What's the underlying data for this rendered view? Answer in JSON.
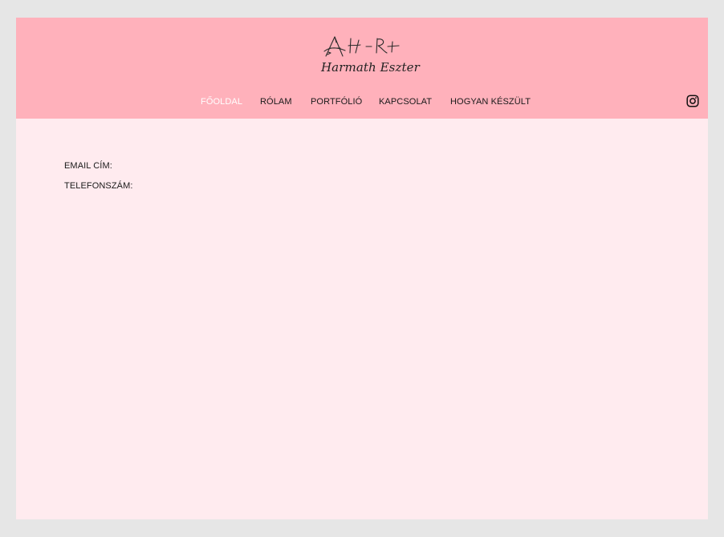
{
  "header": {
    "logo_mark_text": "AH-R+",
    "logo_name": "Harmath Eszter"
  },
  "nav": {
    "items": [
      {
        "label": "FŐOLDAL",
        "active": true
      },
      {
        "label": "RÓLAM",
        "active": false
      },
      {
        "label": "PORTFÓLIÓ",
        "active": false
      },
      {
        "label": "KAPCSOLAT",
        "active": false
      },
      {
        "label": "HOGYAN KÉSZÜLT",
        "active": false
      }
    ],
    "social_icon": "instagram-icon"
  },
  "contact": {
    "email_label": "EMAIL CÍM:",
    "phone_label": "TELEFONSZÁM:"
  },
  "colors": {
    "background": "#e6e6e6",
    "header": "#ffb1bb",
    "page": "#ffebef",
    "active_nav": "#ffffff",
    "text": "#1a1a1a"
  }
}
